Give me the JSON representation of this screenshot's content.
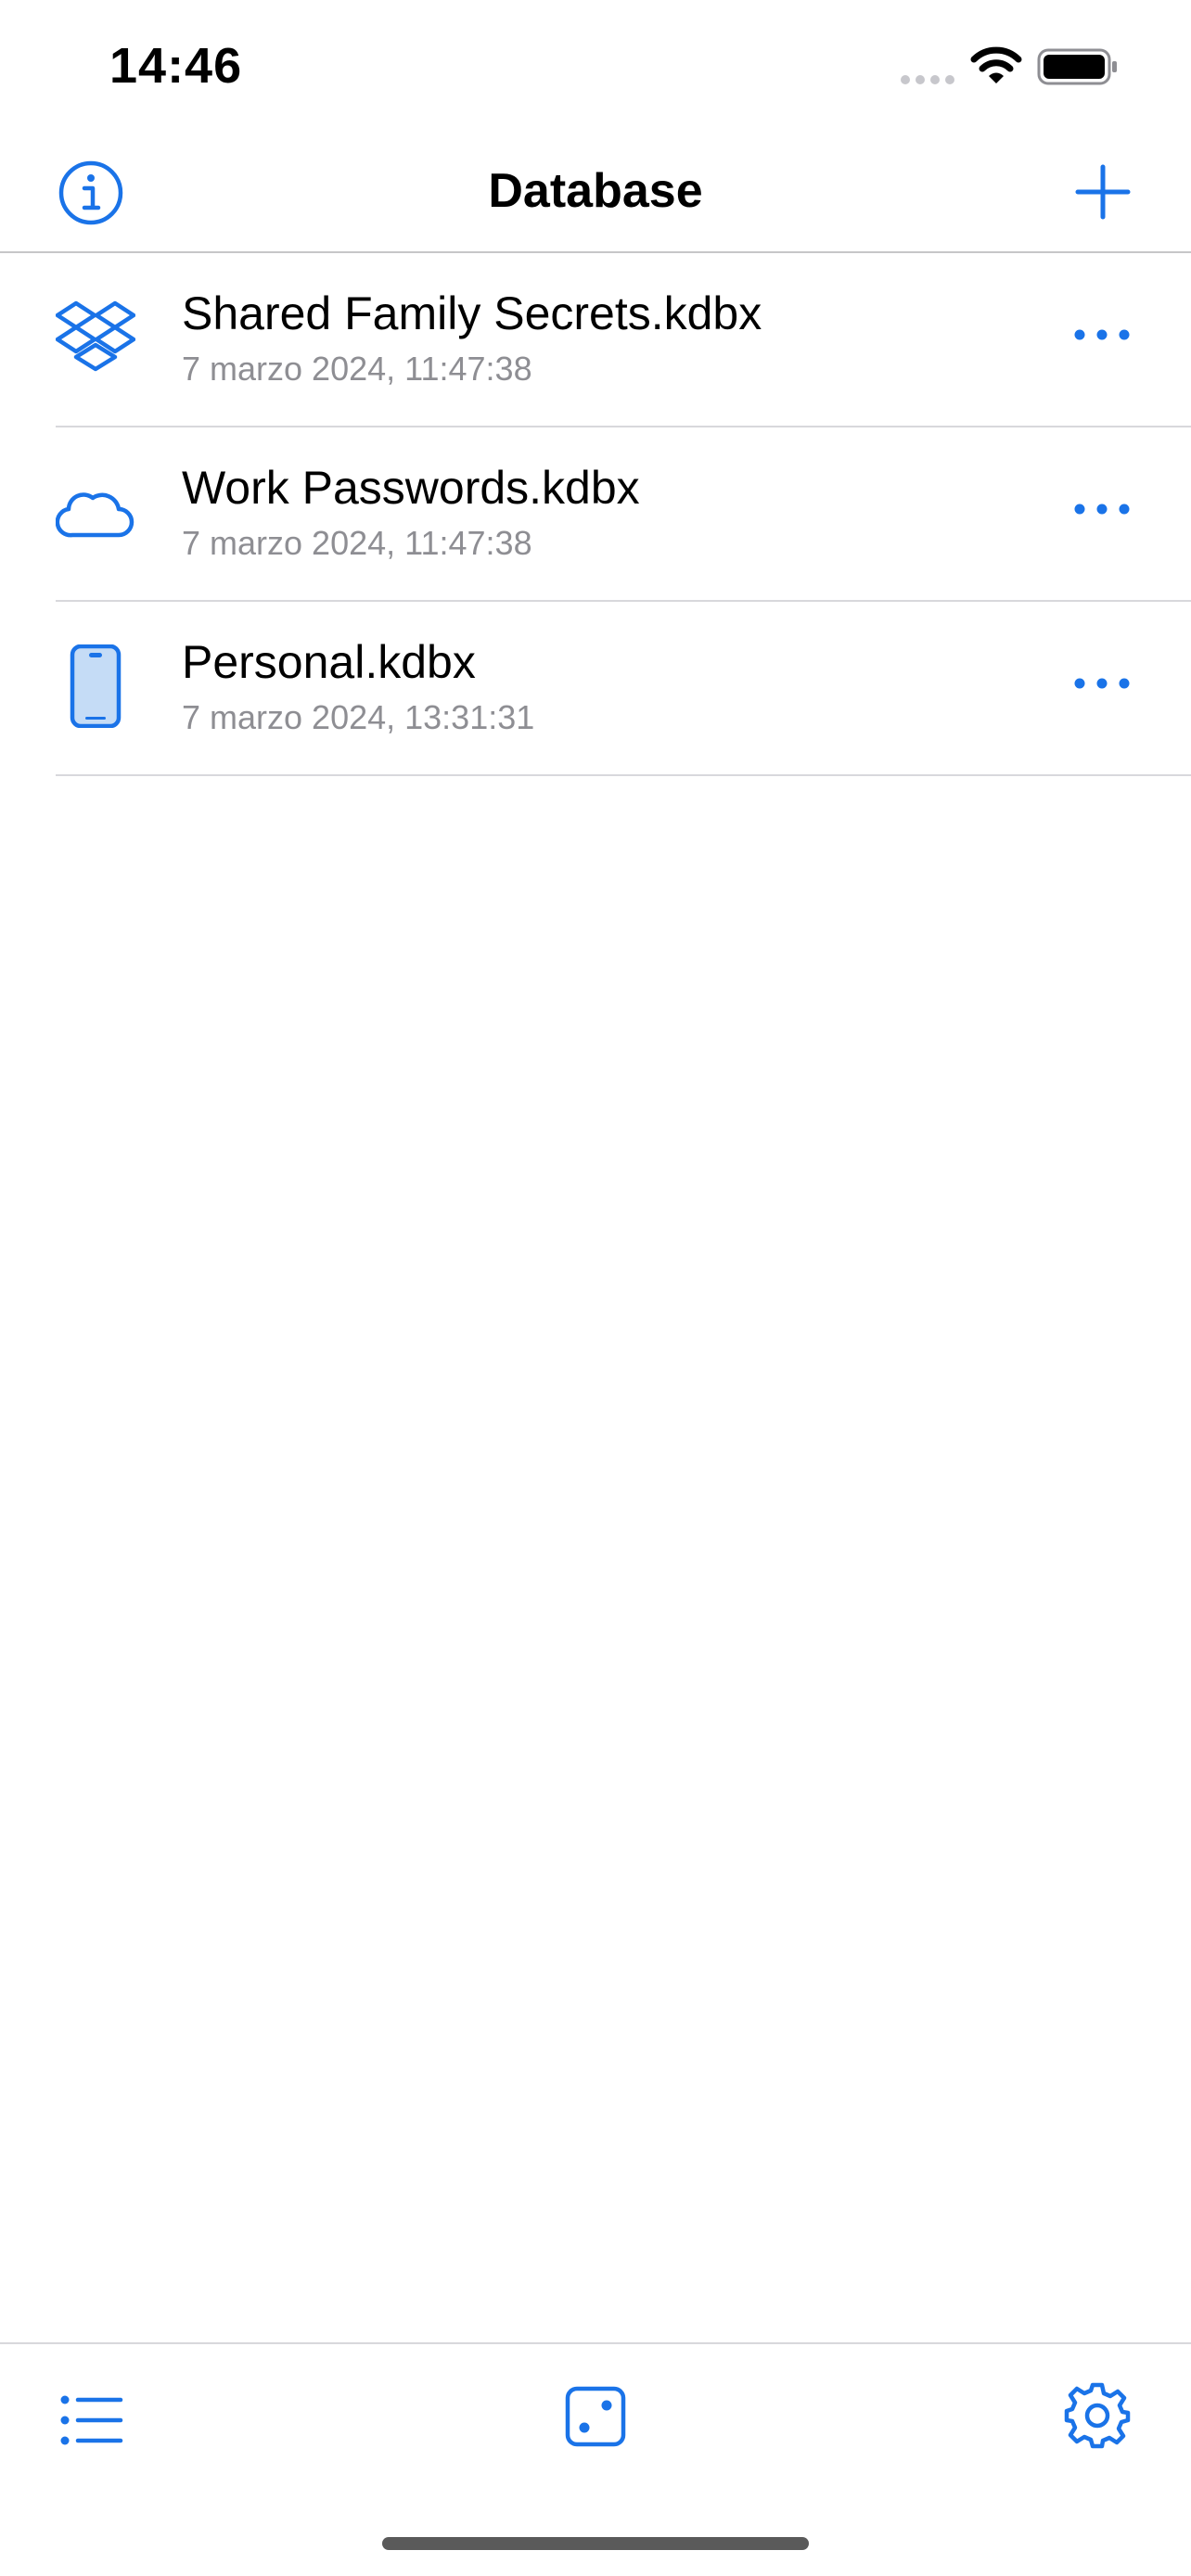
{
  "status_bar": {
    "time": "14:46"
  },
  "nav": {
    "title": "Database"
  },
  "databases": [
    {
      "name": "Shared Family Secrets.kdbx",
      "date": "7 marzo 2024, 11:47:38",
      "icon": "dropbox-icon"
    },
    {
      "name": "Work Passwords.kdbx",
      "date": "7 marzo 2024, 11:47:38",
      "icon": "cloud-icon"
    },
    {
      "name": "Personal.kdbx",
      "date": "7 marzo 2024, 13:31:31",
      "icon": "iphone-icon"
    }
  ],
  "toolbar": {
    "icons": [
      "list-icon",
      "dice-icon",
      "gear-icon"
    ]
  },
  "colors": {
    "accent": "#1a73e8",
    "secondary_text": "#8e8e93",
    "separator": "#d8d8dc"
  }
}
